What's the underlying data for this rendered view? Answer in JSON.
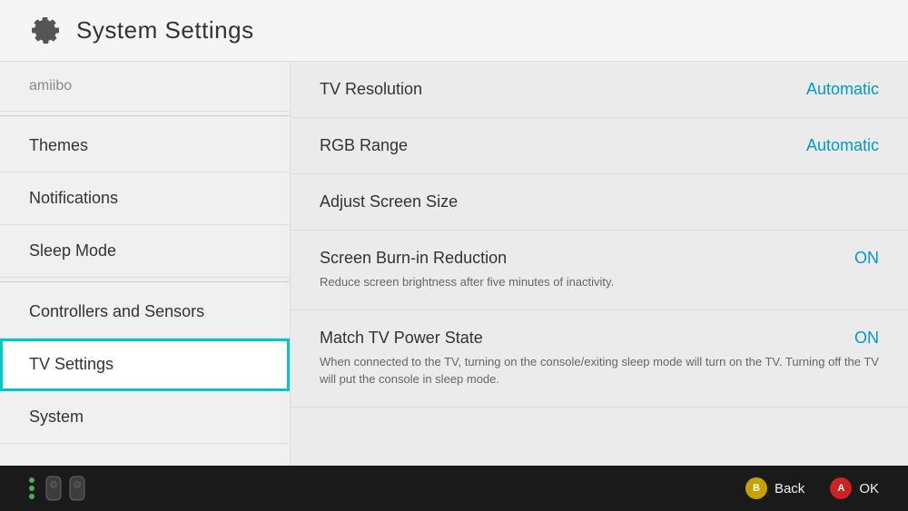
{
  "header": {
    "title": "System Settings",
    "icon": "gear"
  },
  "sidebar": {
    "items": [
      {
        "id": "amiibo",
        "label": "amiibo",
        "dimmed": true,
        "divider_after": true
      },
      {
        "id": "themes",
        "label": "Themes",
        "active": false
      },
      {
        "id": "notifications",
        "label": "Notifications",
        "active": false
      },
      {
        "id": "sleep-mode",
        "label": "Sleep Mode",
        "active": false,
        "divider_after": true
      },
      {
        "id": "controllers",
        "label": "Controllers and Sensors",
        "active": false
      },
      {
        "id": "tv-settings",
        "label": "TV Settings",
        "active": true
      },
      {
        "id": "system",
        "label": "System",
        "active": false
      }
    ]
  },
  "content": {
    "settings": [
      {
        "id": "tv-resolution",
        "label": "TV Resolution",
        "value": "Automatic",
        "description": null
      },
      {
        "id": "rgb-range",
        "label": "RGB Range",
        "value": "Automatic",
        "description": null
      },
      {
        "id": "adjust-screen-size",
        "label": "Adjust Screen Size",
        "value": null,
        "description": null
      },
      {
        "id": "screen-burn-in",
        "label": "Screen Burn-in Reduction",
        "value": "ON",
        "description": "Reduce screen brightness after five minutes of inactivity."
      },
      {
        "id": "match-tv-power",
        "label": "Match TV Power State",
        "value": "ON",
        "description": "When connected to the TV, turning on the console/exiting sleep mode will turn on the TV. Turning off the TV will put the console in sleep mode."
      }
    ]
  },
  "footer": {
    "back_label": "Back",
    "ok_label": "OK",
    "btn_b": "B",
    "btn_a": "A"
  }
}
